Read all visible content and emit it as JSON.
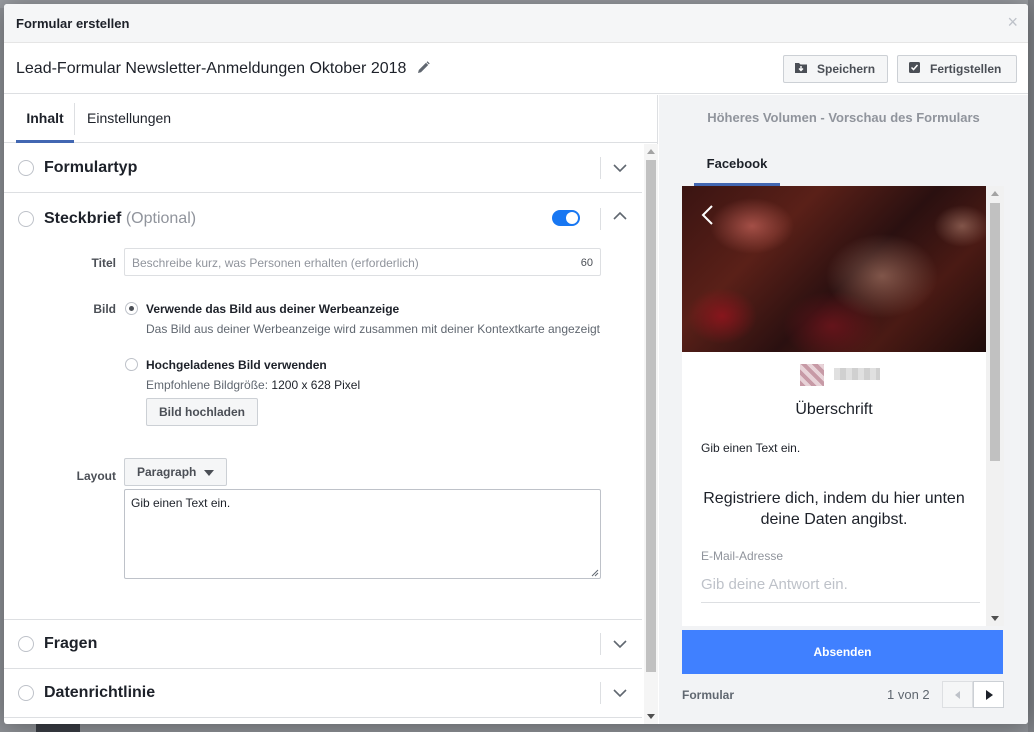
{
  "modal": {
    "title": "Formular erstellen",
    "close": "×"
  },
  "toolbar": {
    "form_name": "Lead-Formular Newsletter-Anmeldungen Oktober 2018",
    "save_label": "Speichern",
    "finish_label": "Fertigstellen"
  },
  "tabs": [
    {
      "label": "Inhalt",
      "active": true
    },
    {
      "label": "Einstellungen",
      "active": false
    }
  ],
  "sections": {
    "formtype": {
      "title": "Formulartyp"
    },
    "brief": {
      "title": "Steckbrief",
      "optional": "(Optional)",
      "enabled": true,
      "title_label": "Titel",
      "title_placeholder": "Beschreibe kurz, was Personen erhalten (erforderlich)",
      "title_remaining": "60",
      "image_label": "Bild",
      "image_options": [
        {
          "title": "Verwende das Bild aus deiner Werbeanzeige",
          "desc": "Das Bild aus deiner Werbeanzeige wird zusammen mit deiner Kontextkarte angezeigt",
          "selected": true
        },
        {
          "title": "Hochgeladenes Bild verwenden",
          "desc_prefix": "Empfohlene Bildgröße:",
          "desc_value": "1200 x 628 Pixel",
          "selected": false
        }
      ],
      "upload_label": "Bild hochladen",
      "layout_label": "Layout",
      "layout_value": "Paragraph",
      "text_value": "Gib einen Text ein."
    },
    "questions": {
      "title": "Fragen"
    },
    "privacy": {
      "title": "Datenrichtlinie"
    }
  },
  "preview": {
    "title": "Höheres Volumen - Vorschau des Formulars",
    "platform_tab": "Facebook",
    "headline": "Überschrift",
    "text": "Gib einen Text ein.",
    "intro": "Registriere dich, indem du hier unten deine Daten angibst.",
    "field_label": "E-Mail-Adresse",
    "field_placeholder": "Gib deine Antwort ein.",
    "submit_label": "Absenden",
    "footer_label": "Formular",
    "page_indicator": "1 von 2"
  },
  "colors": {
    "accent": "#4267b2",
    "toggle_on": "#1877f2",
    "submit": "#4080ff"
  },
  "icons": [
    "pencil-icon",
    "save-icon",
    "finish-icon",
    "chevron-down-icon",
    "chevron-up-icon",
    "close-icon",
    "back-arrow-icon",
    "caret-down-icon"
  ]
}
